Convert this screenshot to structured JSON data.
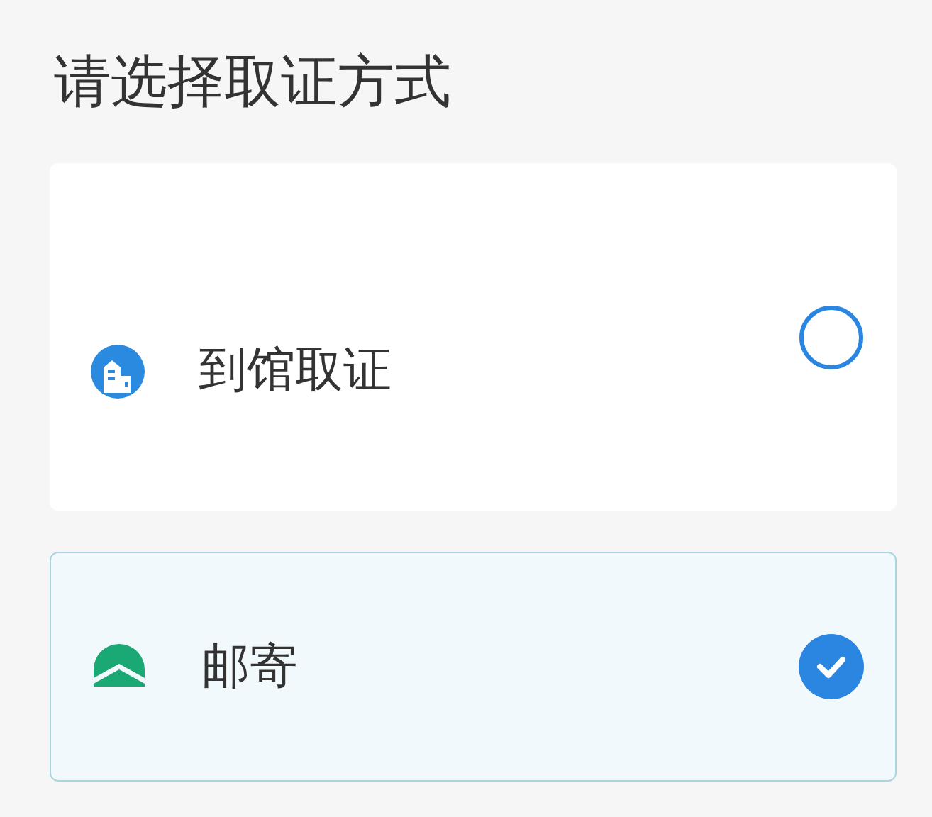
{
  "title": "请选择取证方式",
  "options": [
    {
      "kind": "building",
      "label": "到馆取证",
      "selected": false
    },
    {
      "kind": "mail",
      "label": "邮寄",
      "selected": true
    }
  ]
}
